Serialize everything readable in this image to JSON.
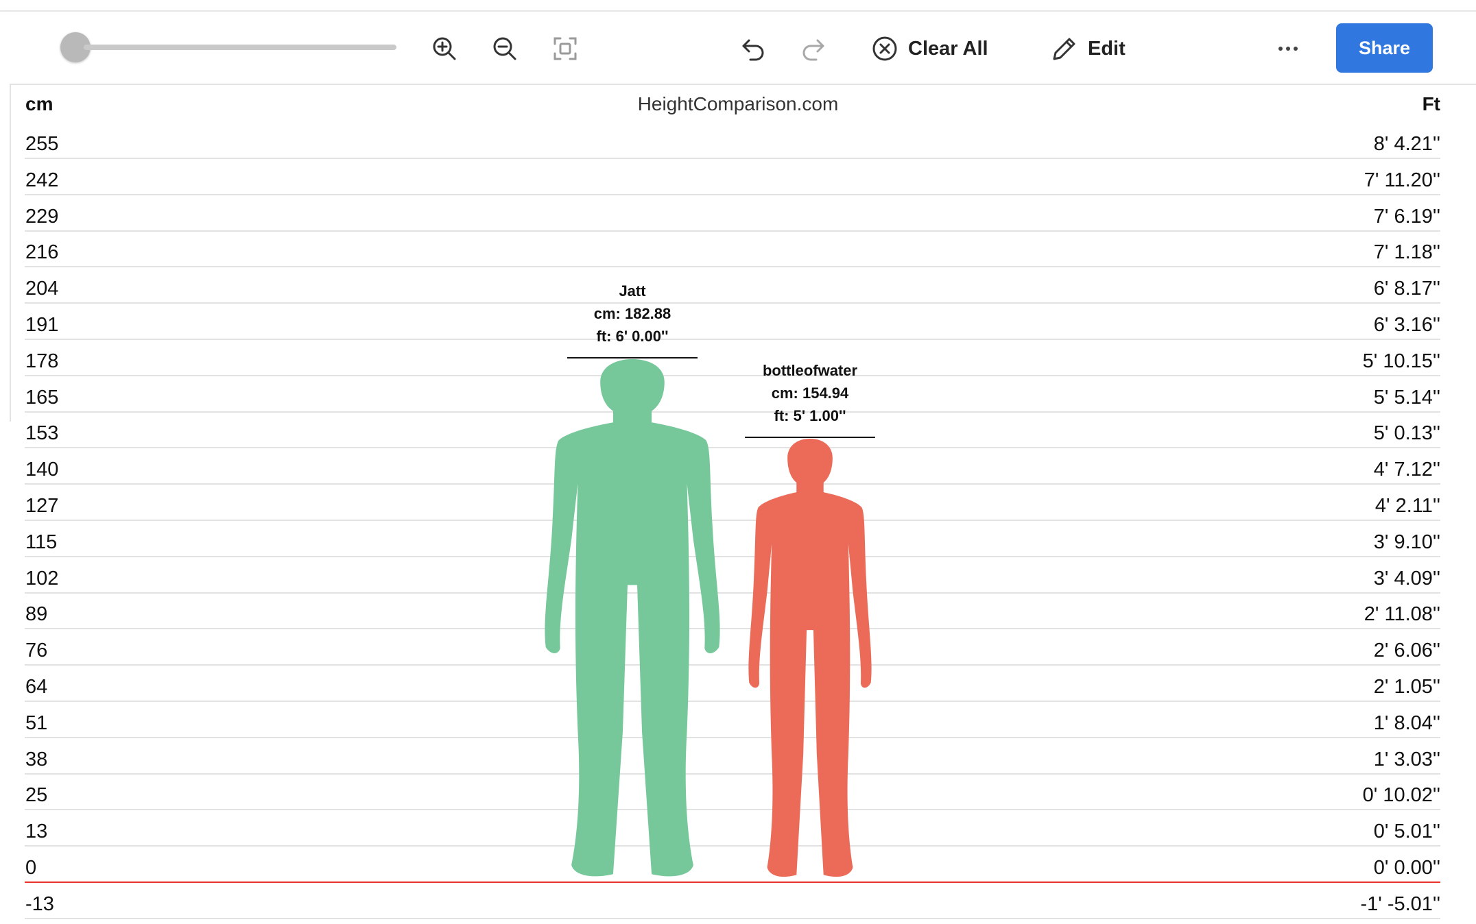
{
  "toolbar": {
    "zoom_slider_value": 0,
    "zoom_in_icon": "zoom-in-icon",
    "zoom_out_icon": "zoom-out-icon",
    "fit_icon": "fit-to-screen-icon",
    "undo_icon": "undo-icon",
    "redo_icon": "redo-icon",
    "clear_all_label": "Clear All",
    "clear_all_icon": "x-circle-icon",
    "edit_label": "Edit",
    "edit_icon": "pencil-icon",
    "more_icon": "more-dots-icon",
    "share_label": "Share"
  },
  "chart": {
    "left_unit": "cm",
    "right_unit": "Ft",
    "site_name": "HeightComparison.com",
    "ticks": [
      {
        "cm": "255",
        "ft": "8' 4.21''"
      },
      {
        "cm": "242",
        "ft": "7' 11.20''"
      },
      {
        "cm": "229",
        "ft": "7' 6.19''"
      },
      {
        "cm": "216",
        "ft": "7' 1.18''"
      },
      {
        "cm": "204",
        "ft": "6' 8.17''"
      },
      {
        "cm": "191",
        "ft": "6' 3.16''"
      },
      {
        "cm": "178",
        "ft": "5' 10.15''"
      },
      {
        "cm": "165",
        "ft": "5' 5.14''"
      },
      {
        "cm": "153",
        "ft": "5' 0.13''"
      },
      {
        "cm": "140",
        "ft": "4' 7.12''"
      },
      {
        "cm": "127",
        "ft": "4' 2.11''"
      },
      {
        "cm": "115",
        "ft": "3' 9.10''"
      },
      {
        "cm": "102",
        "ft": "3' 4.09''"
      },
      {
        "cm": "89",
        "ft": "2' 11.08''"
      },
      {
        "cm": "76",
        "ft": "2' 6.06''"
      },
      {
        "cm": "64",
        "ft": "2' 1.05''"
      },
      {
        "cm": "51",
        "ft": "1' 8.04''"
      },
      {
        "cm": "38",
        "ft": "1' 3.03''"
      },
      {
        "cm": "25",
        "ft": "0' 10.02''"
      },
      {
        "cm": "13",
        "ft": "0' 5.01''"
      },
      {
        "cm": "0",
        "ft": "0' 0.00''"
      },
      {
        "cm": "-13",
        "ft": "-1' -5.01''"
      }
    ],
    "people": [
      {
        "name": "Jatt",
        "cm_text": "cm: 182.88",
        "ft_text": "ft: 6' 0.00''",
        "height_cm": 182.88,
        "color": "#76c89b"
      },
      {
        "name": "bottleofwater",
        "cm_text": "cm: 154.94",
        "ft_text": "ft: 5' 1.00''",
        "height_cm": 154.94,
        "color": "#ec6b58"
      }
    ]
  }
}
